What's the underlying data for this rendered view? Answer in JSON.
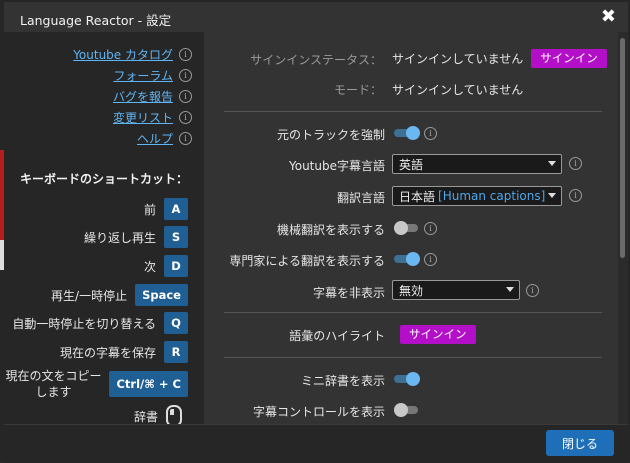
{
  "window": {
    "title": "Language Reactor - 設定",
    "close_glyph": "✖"
  },
  "links": [
    {
      "label": "Youtube カタログ"
    },
    {
      "label": "フォーラム"
    },
    {
      "label": "バグを報告"
    },
    {
      "label": "変更リスト"
    },
    {
      "label": "ヘルプ"
    }
  ],
  "shortcuts": {
    "title": "キーボードのショートカット：",
    "items": [
      {
        "label": "前",
        "key": "A"
      },
      {
        "label": "繰り返し再生",
        "key": "S"
      },
      {
        "label": "次",
        "key": "D"
      },
      {
        "label": "再生/一時停止",
        "key": "Space"
      },
      {
        "label": "自動一時停止を切り替える",
        "key": "Q"
      },
      {
        "label": "現在の字幕を保存",
        "key": "R"
      },
      {
        "label": "現在の文をコピーします",
        "key": "Ctrl/⌘ + C"
      },
      {
        "label": "辞書",
        "key": "mouse-icon"
      }
    ]
  },
  "settings": {
    "signin_status_label": "サインインステータス：",
    "signin_status_value": "サインインしていません",
    "signin_button": "サインイン",
    "mode_label": "モード：",
    "mode_value": "サインインしていません",
    "original_track_label": "元のトラックを強制",
    "original_track_on": true,
    "yt_sub_lang_label": "Youtube字幕言語",
    "yt_sub_lang_value": "英語",
    "translation_lang_label": "翻訳言語",
    "translation_lang_value": "日本語",
    "translation_lang_extra": "[Human captions]",
    "machine_trans_label": "機械翻訳を表示する",
    "machine_trans_on": false,
    "expert_trans_label": "専門家による翻訳を表示する",
    "expert_trans_on": true,
    "hide_subs_label": "字幕を非表示",
    "hide_subs_value": "無効",
    "vocab_highlight_label": "語彙のハイライト",
    "vocab_signin_button": "サインイン",
    "mini_dict_label": "ミニ辞書を表示",
    "mini_dict_on": true,
    "sub_controls_label": "字幕コントロールを表示",
    "sub_controls_on": false
  },
  "footer": {
    "close_button": "閉じる"
  },
  "colors": {
    "accent": "#1e6fb8",
    "signin": "#b40fc8",
    "toggle_on": "#6bb7f0",
    "link": "#5fb4f2"
  }
}
